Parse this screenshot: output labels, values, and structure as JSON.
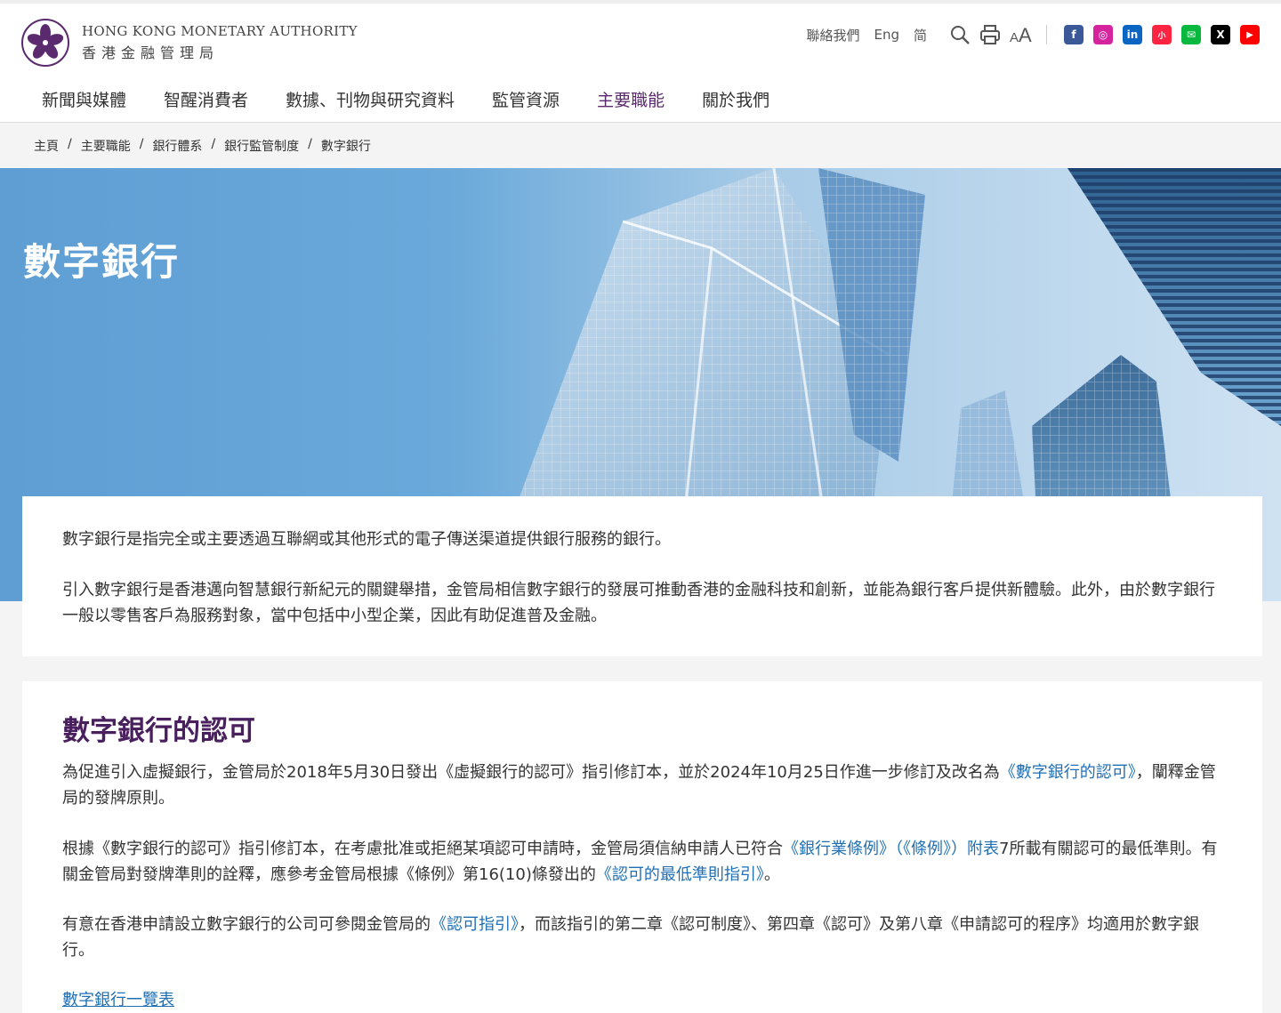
{
  "header": {
    "logo_en": "HONG KONG MONETARY AUTHORITY",
    "logo_zh": "香港金融管理局",
    "contact": "聯絡我們",
    "lang_en": "Eng",
    "lang_sc": "简",
    "icons": [
      "search-icon",
      "print-icon",
      "font-size-icon"
    ],
    "social": [
      {
        "name": "facebook-icon",
        "color": "#3b5998",
        "glyph": "f"
      },
      {
        "name": "instagram-icon",
        "color": "#d6249f",
        "glyph": "◎"
      },
      {
        "name": "linkedin-icon",
        "color": "#0a66c2",
        "glyph": "in"
      },
      {
        "name": "xiaohongshu-icon",
        "color": "#ff2442",
        "glyph": "小"
      },
      {
        "name": "wechat-icon",
        "color": "#09b83e",
        "glyph": "✉"
      },
      {
        "name": "x-icon",
        "color": "#000000",
        "glyph": "X"
      },
      {
        "name": "youtube-icon",
        "color": "#ff0000",
        "glyph": "▶"
      }
    ]
  },
  "nav": {
    "items": [
      {
        "label": "新聞與媒體"
      },
      {
        "label": "智醒消費者"
      },
      {
        "label": "數據、刊物與研究資料"
      },
      {
        "label": "監管資源"
      },
      {
        "label": "主要職能"
      },
      {
        "label": "關於我們"
      }
    ],
    "active_index": 4
  },
  "breadcrumb": [
    "主頁",
    "主要職能",
    "銀行體系",
    "銀行監管制度",
    "數字銀行"
  ],
  "hero": {
    "title": "數字銀行"
  },
  "intro": {
    "p1": "數字銀行是指完全或主要透過互聯網或其他形式的電子傳送渠道提供銀行服務的銀行。",
    "p2": "引入數字銀行是香港邁向智慧銀行新紀元的關鍵舉措，金管局相信數字銀行的發展可推動香港的金融科技和創新，並能為銀行客戶提供新體驗。此外，由於數字銀行一般以零售客戶為服務對象，當中包括中小型企業，因此有助促進普及金融。"
  },
  "authorization": {
    "heading": "數字銀行的認可",
    "p1_a": "為促進引入虛擬銀行，金管局於2018年5月30日發出《虛擬銀行的認可》指引修訂本，並於2024年10月25日作進一步修訂及改名為",
    "p1_link": "《數字銀行的認可》",
    "p1_b": "，闡釋金管局的發牌原則。",
    "p2_a": "根據《數字銀行的認可》指引修訂本，在考慮批准或拒絕某項認可申請時，金管局須信納申請人已符合",
    "p2_link1": "《銀行業條例》（《條例》）附表",
    "p2_b": "7所載有關認可的最低準則。有關金管局對發牌準則的詮釋，應參考金管局根據《條例》第16(10)條發出的",
    "p2_link2": "《認可的最低準則指引》",
    "p2_c": "。",
    "p3_a": "有意在香港申請設立數字銀行的公司可參閱金管局的",
    "p3_link": "《認可指引》",
    "p3_b": "，而該指引的第二章《認可制度》、第四章《認可》及第八章《申請認可的程序》均適用於數字銀行。",
    "list_link": "數字銀行一覽表"
  },
  "colors": {
    "brand": "#5b2a6e",
    "link": "#1f6fb5"
  }
}
